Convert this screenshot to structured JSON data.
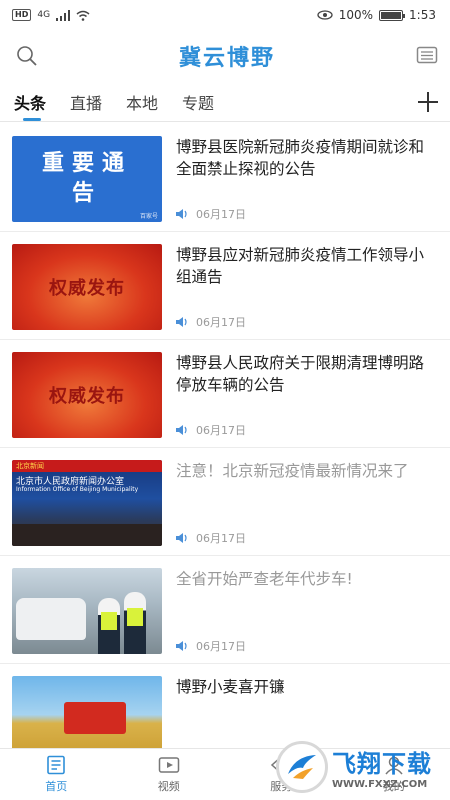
{
  "status_bar": {
    "hd": "HD",
    "network": "4G",
    "battery_text": "100%",
    "battery_level": 1.0,
    "time": "1:53"
  },
  "header": {
    "title": "冀云博野",
    "left_icon": "search-icon",
    "right_icon": "message-icon"
  },
  "tabs": [
    {
      "label": "头条",
      "active": true
    },
    {
      "label": "直播",
      "active": false
    },
    {
      "label": "本地",
      "active": false
    },
    {
      "label": "专题",
      "active": false
    }
  ],
  "news": [
    {
      "title": "博野县医院新冠肺炎疫情期间就诊和全面禁止探视的公告",
      "date": "06月17日",
      "thumb_text": "重要通告",
      "thumb_small": "百家号",
      "read": false
    },
    {
      "title": "博野县应对新冠肺炎疫情工作领导小组通告",
      "date": "06月17日",
      "thumb_text": "权威发布",
      "read": false
    },
    {
      "title": "博野县人民政府关于限期清理博明路停放车辆的公告",
      "date": "06月17日",
      "thumb_text": "权威发布",
      "read": false
    },
    {
      "title": "注意！北京新冠疫情最新情况来了",
      "date": "06月17日",
      "thumb_banner": "北京新闻",
      "thumb_cn": "北京市人民政府新闻办公室",
      "thumb_en": "Information Office of Beijing Municipality",
      "read": true
    },
    {
      "title": "全省开始严查老年代步车!",
      "date": "06月17日",
      "read": true
    },
    {
      "title": "博野小麦喜开镰",
      "date": "",
      "read": false
    }
  ],
  "bottom_nav": [
    {
      "label": "首页",
      "icon": "news-icon",
      "active": true
    },
    {
      "label": "视频",
      "icon": "video-icon",
      "active": false
    },
    {
      "label": "服务",
      "icon": "service-icon",
      "active": false
    },
    {
      "label": "我的",
      "icon": "profile-icon",
      "active": false
    }
  ],
  "watermark": {
    "cn": "飞翔下载",
    "url": "WWW.FXXZ.COM"
  },
  "colors": {
    "accent": "#2f8fd8",
    "title_blue": "#2f8fd8"
  }
}
